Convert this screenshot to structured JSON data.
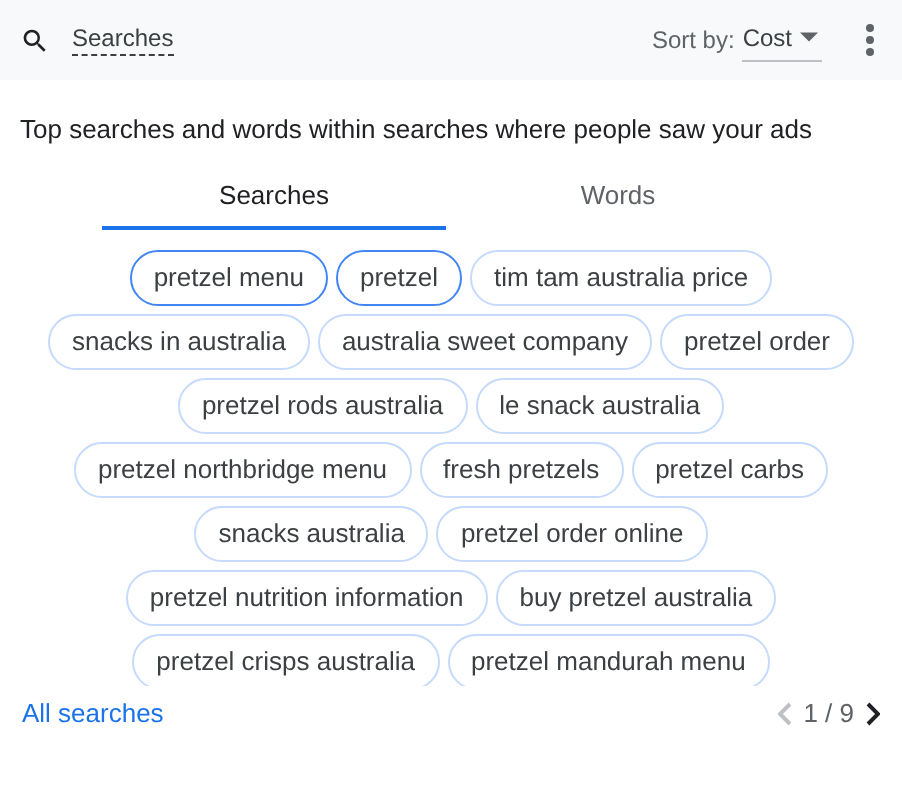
{
  "header": {
    "search_label": "Searches",
    "sort_label": "Sort by:",
    "sort_value": "Cost"
  },
  "description": "Top searches and words within searches where people saw your ads",
  "tabs": [
    {
      "label": "Searches",
      "selected": true
    },
    {
      "label": "Words",
      "selected": false
    }
  ],
  "chip_rows": [
    [
      {
        "label": "pretzel menu",
        "selected": true
      },
      {
        "label": "pretzel",
        "selected": true
      },
      {
        "label": "tim tam australia price",
        "selected": false
      }
    ],
    [
      {
        "label": "snacks in australia",
        "selected": false
      },
      {
        "label": "australia sweet company",
        "selected": false
      },
      {
        "label": "pretzel order",
        "selected": false
      }
    ],
    [
      {
        "label": "pretzel rods australia",
        "selected": false
      },
      {
        "label": "le snack australia",
        "selected": false
      }
    ],
    [
      {
        "label": "pretzel northbridge menu",
        "selected": false
      },
      {
        "label": "fresh pretzels",
        "selected": false
      },
      {
        "label": "pretzel carbs",
        "selected": false
      }
    ],
    [
      {
        "label": "snacks australia",
        "selected": false
      },
      {
        "label": "pretzel order online",
        "selected": false
      }
    ],
    [
      {
        "label": "pretzel nutrition information",
        "selected": false
      },
      {
        "label": "buy pretzel australia",
        "selected": false
      }
    ],
    [
      {
        "label": "pretzel crisps australia",
        "selected": false
      },
      {
        "label": "pretzel mandurah menu",
        "selected": false
      }
    ]
  ],
  "footer": {
    "link": "All searches",
    "page": "1 / 9"
  }
}
